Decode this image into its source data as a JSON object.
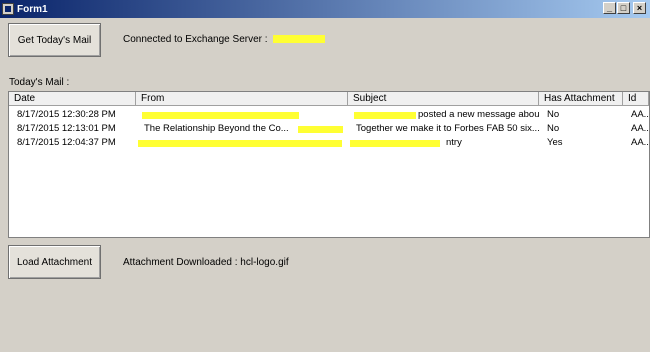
{
  "window": {
    "title": "Form1",
    "min_label": "_",
    "max_label": "□",
    "close_label": "×"
  },
  "top": {
    "get_mail_label": "Get Today's Mail",
    "status_prefix": "Connected to Exchange Server :"
  },
  "mail": {
    "section_label": "Today's Mail :",
    "columns": [
      "Date",
      "From",
      "Subject",
      "Has Attachment",
      "Id"
    ],
    "rows": [
      {
        "date": "8/17/2015 12:30:28 PM",
        "from": "",
        "subject": "posted a new message about...",
        "attach": "No",
        "id": "AA..."
      },
      {
        "date": "8/17/2015 12:13:01 PM",
        "from": "The Relationship Beyond the Co...",
        "subject": "Together we make it to Forbes FAB 50 six...",
        "attach": "No",
        "id": "AA..."
      },
      {
        "date": "8/17/2015 12:04:37 PM",
        "from": "",
        "subject": "ntry",
        "attach": "Yes",
        "id": "AA..."
      }
    ]
  },
  "bottom": {
    "load_label": "Load Attachment",
    "download_status": "Attachment Downloaded : hcl-logo.gif"
  },
  "colors": {
    "highlight": "#ffff33",
    "titlebar": "#0a246a",
    "form_bg": "#d4d0c8"
  }
}
